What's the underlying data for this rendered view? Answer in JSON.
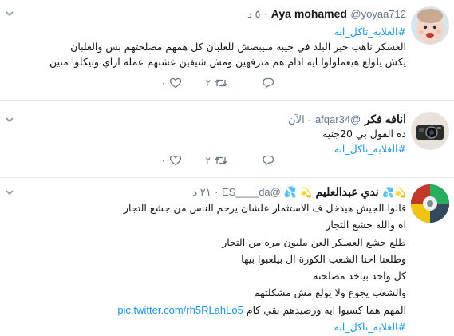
{
  "colors": {
    "accent": "#1b95e0",
    "text": "#14171a",
    "muted": "#657786",
    "divider": "#e6ecf0"
  },
  "tweets": [
    {
      "name": "Aya mohamed",
      "handle": "@yoyaa712",
      "dot": "·",
      "time": "٥ د",
      "hashtag": "#الغلابه_تاكل_ابه",
      "lines": [
        "العسكر ناهب خير البلد في جيبه مبيبصش للغلبان كل همهم مصلحتهم بس والغلبان",
        "يكش يلولع هيعملولوا ايه ادام هم مترفهين ومش شيفين عشتهم عمله ازاي وبيكلوا منين"
      ],
      "replies": "",
      "retweets": "٢",
      "likes": "٠",
      "avatar_icon": "baby-photo-icon"
    },
    {
      "name": "انافه فكر",
      "handle": "@afqar34",
      "dot": "·",
      "time": "الآن",
      "hashtag": "#الغلابه_تاكل_ابه",
      "lines": [
        "ده الفول بي 20جنيه"
      ],
      "replies": "",
      "retweets": "٢",
      "likes": "٠",
      "avatar_icon": "camera-photo-icon"
    },
    {
      "name": "ندي عبدالعليم",
      "emoji_before": "💫💦",
      "emoji_after": "💫",
      "handle": "@ES____da",
      "handle_emoji": "💦",
      "dot": "·",
      "time": "٢١ د",
      "lines": [
        "قالوا الجيش هيدخل ف الاستثمار علشان يرحم الناس من جشع التجار",
        "اه والله جشع التجار",
        "طلع جشع العسكر العن مليون مره من التجار",
        "وطلعنا احنا الشعب الكورة ال بيلعبوا بيها",
        "كل واحد بياخد مصلحته",
        "والشعب يجوع ولا يولع مش مشكلتهم",
        "المهم هما كسبوا ايه ورصيدهم بقي كام"
      ],
      "hashtag": "#الغلابه_تاكل_ابه",
      "link": "pic.twitter.com/rh5RLahLo5",
      "avatar_icon": "collage-photo-icon"
    }
  ]
}
